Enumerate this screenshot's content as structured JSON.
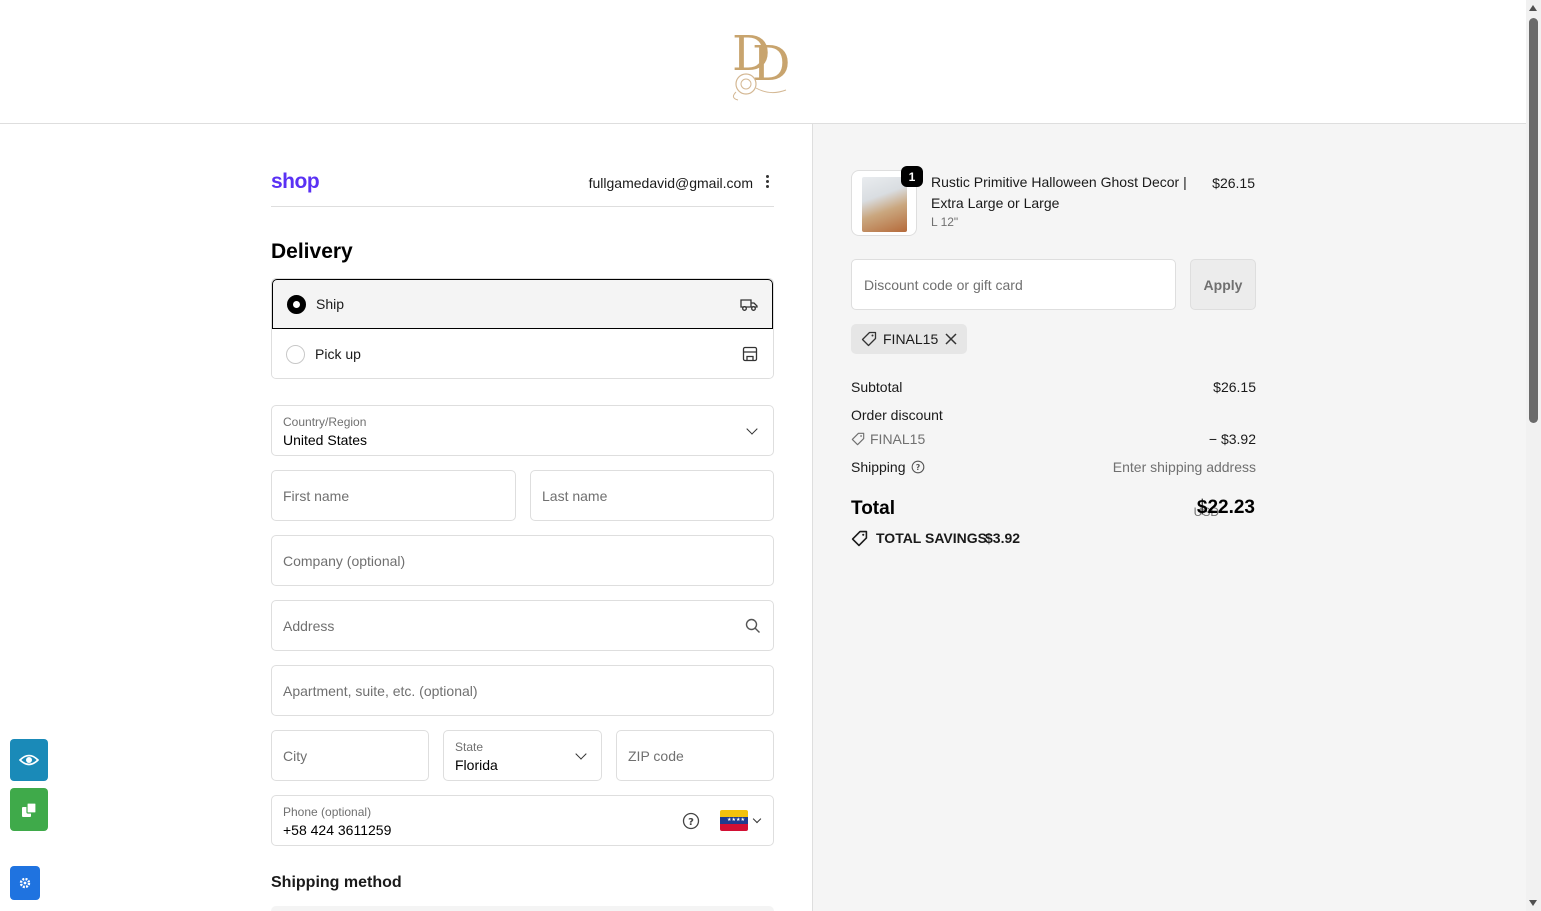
{
  "header": {
    "logo_alt": "DD floral monogram logo"
  },
  "account": {
    "shop_logo": "shop",
    "email": "fullgamedavid@gmail.com"
  },
  "delivery": {
    "heading": "Delivery",
    "options": [
      {
        "label": "Ship",
        "selected": true,
        "icon": "truck-icon"
      },
      {
        "label": "Pick up",
        "selected": false,
        "icon": "store-icon"
      }
    ],
    "country": {
      "label": "Country/Region",
      "value": "United States"
    },
    "first_name": {
      "placeholder": "First name"
    },
    "last_name": {
      "placeholder": "Last name"
    },
    "company": {
      "placeholder": "Company (optional)"
    },
    "address": {
      "placeholder": "Address"
    },
    "apartment": {
      "placeholder": "Apartment, suite, etc. (optional)"
    },
    "city": {
      "placeholder": "City"
    },
    "state": {
      "label": "State",
      "value": "Florida"
    },
    "zip": {
      "placeholder": "ZIP code"
    },
    "phone": {
      "label": "Phone (optional)",
      "value": "+58 424 3611259",
      "flag": "venezuela-flag-icon"
    },
    "shipping_method_heading": "Shipping method"
  },
  "order": {
    "item": {
      "quantity": "1",
      "title": "Rustic Primitive Halloween Ghost Decor | Extra Large or Large",
      "variant": "L 12\"",
      "price": "$26.15"
    },
    "discount": {
      "placeholder": "Discount code or gift card",
      "apply_label": "Apply"
    },
    "applied_code": "FINAL15",
    "subtotal_label": "Subtotal",
    "subtotal_value": "$26.15",
    "order_discount_label": "Order discount",
    "discount_code": "FINAL15",
    "discount_value": "− $3.92",
    "shipping_label": "Shipping",
    "shipping_value": "Enter shipping address",
    "total_label": "Total",
    "currency": "USD",
    "total_value": "$22.23",
    "savings_label": "TOTAL SAVINGS",
    "savings_value": "$3.92"
  },
  "colors": {
    "shop_purple": "#5a31f4",
    "accent_blue": "#1a8ab8",
    "accent_green": "#3faa4a",
    "gear_blue": "#1f73e0"
  }
}
